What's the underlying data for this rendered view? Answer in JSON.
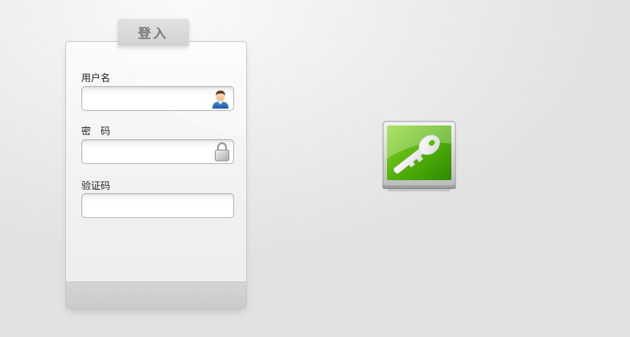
{
  "login": {
    "title": "登入",
    "username": {
      "label": "用户名",
      "value": "",
      "icon": "user-icon"
    },
    "password": {
      "label": "密　码",
      "value": "",
      "icon": "lock-icon"
    },
    "captcha": {
      "label": "验证码",
      "value": ""
    }
  },
  "decoration": {
    "icon": "key-icon",
    "accent_color": "#5cb80c"
  }
}
